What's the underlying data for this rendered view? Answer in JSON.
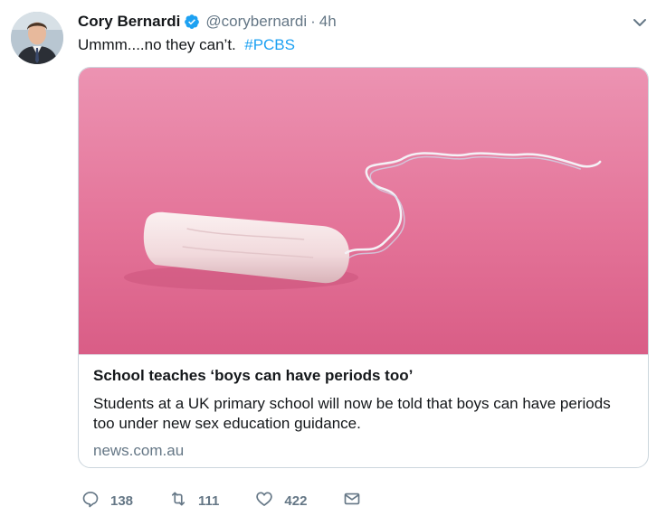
{
  "tweet": {
    "author_name": "Cory Bernardi",
    "handle": "@corybernardi",
    "separator": "·",
    "time": "4h",
    "text": "Ummm....no they can’t.",
    "hashtag": "#PCBS"
  },
  "card": {
    "title": "School teaches ‘boys can have periods too’",
    "description": "Students at a UK primary school will now be told that boys can have periods too under new sex education guidance.",
    "domain": "news.com.au"
  },
  "actions": {
    "replies": "138",
    "retweets": "111",
    "likes": "422"
  },
  "colors": {
    "accent": "#1da1f2",
    "secondary_text": "#657786",
    "image_background": "#e67ea0"
  },
  "icons": {
    "verified": "verified-badge-icon",
    "menu": "chevron-down-icon",
    "reply": "reply-icon",
    "retweet": "retweet-icon",
    "like": "heart-icon",
    "message": "envelope-icon"
  }
}
